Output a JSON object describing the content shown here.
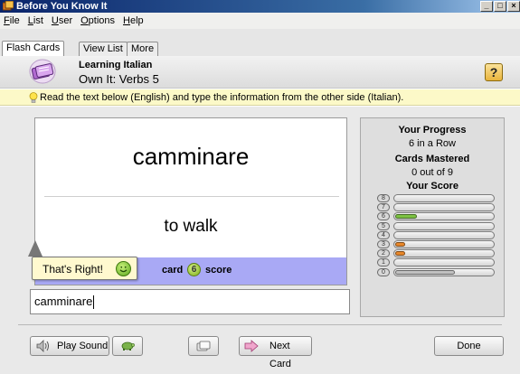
{
  "window": {
    "title": "Before You Know It",
    "controls": [
      "_",
      "□",
      "×"
    ]
  },
  "menu": [
    "File",
    "List",
    "User",
    "Options",
    "Help"
  ],
  "tabs": [
    {
      "label": "Flash Cards",
      "active": true
    },
    {
      "label": "View List",
      "active": false
    },
    {
      "label": "More",
      "active": false
    }
  ],
  "header": {
    "title": "Learning Italian",
    "subtitle": "Own It: Verbs 5",
    "help_symbol": "?"
  },
  "instruction": "Read the text below (English) and type the information from the other side (Italian).",
  "card": {
    "front": "camminare",
    "back": "to walk",
    "card_label": "card",
    "card_number": "6",
    "score_label": "score"
  },
  "feedback": "That's Right!",
  "answer_value": "camminare",
  "progress": {
    "heading": "Your Progress",
    "streak": "6 in a Row",
    "mastered_heading": "Cards Mastered",
    "mastered_value": "0 out of 9",
    "score_heading": "Your Score",
    "score_rows": [
      {
        "level": "8",
        "fill": 0,
        "color": ""
      },
      {
        "level": "7",
        "fill": 0,
        "color": ""
      },
      {
        "level": "6",
        "fill": 0.22,
        "color": "#7cc242"
      },
      {
        "level": "5",
        "fill": 0,
        "color": ""
      },
      {
        "level": "4",
        "fill": 0,
        "color": ""
      },
      {
        "level": "3",
        "fill": 0.1,
        "color": "#e8872a"
      },
      {
        "level": "2",
        "fill": 0.1,
        "color": "#e8872a"
      },
      {
        "level": "1",
        "fill": 0,
        "color": ""
      },
      {
        "level": "0",
        "fill": 0.6,
        "color": "#c0c0c0"
      }
    ]
  },
  "buttons": {
    "play_sound": "Play Sound",
    "next_card": "Next Card",
    "done": "Done"
  }
}
